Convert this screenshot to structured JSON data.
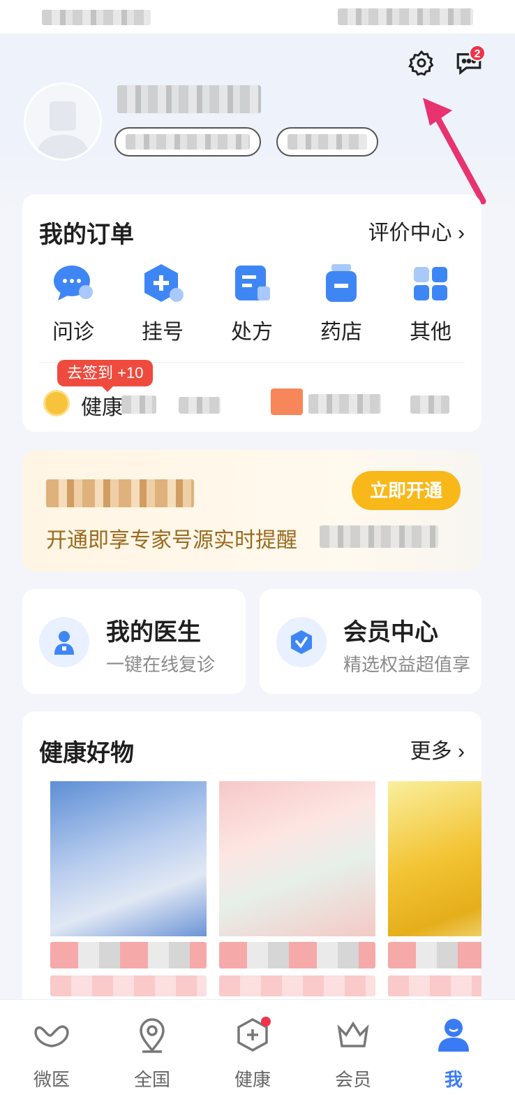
{
  "header": {
    "message_badge": "2"
  },
  "orders": {
    "title": "我的订单",
    "review_link": "评价中心 ›",
    "items": [
      {
        "label": "问诊",
        "icon": "chat-bubble-icon"
      },
      {
        "label": "挂号",
        "icon": "hexagon-plus-icon"
      },
      {
        "label": "处方",
        "icon": "prescription-icon"
      },
      {
        "label": "药店",
        "icon": "pill-bottle-icon"
      },
      {
        "label": "其他",
        "icon": "grid-icon"
      }
    ],
    "signin_label": "去签到 +10",
    "health_label": "健康"
  },
  "vip": {
    "subtitle": "开通即享专家号源实时提醒",
    "button": "立即开通"
  },
  "shortcuts": {
    "doctor": {
      "title": "我的医生",
      "subtitle": "一键在线复诊"
    },
    "member": {
      "title": "会员中心",
      "subtitle": "精选权益超值享"
    }
  },
  "goods": {
    "title": "健康好物",
    "more": "更多 ›"
  },
  "tabbar": {
    "items": [
      {
        "label": "微医"
      },
      {
        "label": "全国"
      },
      {
        "label": "健康"
      },
      {
        "label": "会员"
      },
      {
        "label": "我"
      }
    ]
  },
  "colors": {
    "accent": "#3a7bf5",
    "badge": "#f0334a",
    "vip_button": "#f9b81a",
    "signin": "#ef4a3e",
    "arrow": "#e8336f"
  }
}
